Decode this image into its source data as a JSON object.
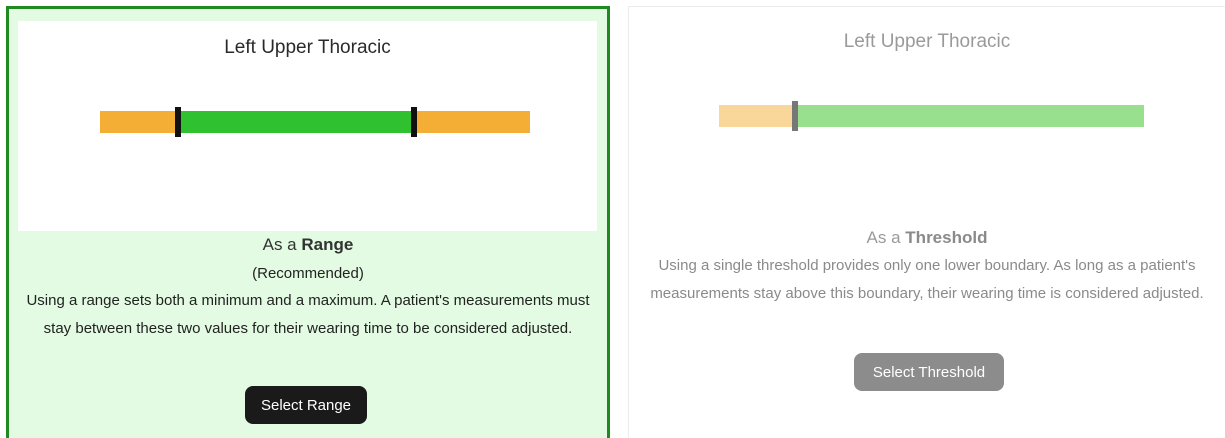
{
  "range_option": {
    "preview_title": "Left Upper Thoracic",
    "heading_prefix": "As a",
    "heading_bold": "Range",
    "subtitle": "(Recommended)",
    "description": "Using a range sets both a minimum and a maximum. A patient's measurements must stay between these two values for their wearing time to be considered adjusted.",
    "button_label": "Select Range",
    "selected": true,
    "colors": {
      "out_of_range": "#f5ae35",
      "in_range": "#2fc12f",
      "marker": "#111111",
      "border": "#1f8a1f",
      "background": "#e3fbe3"
    }
  },
  "threshold_option": {
    "preview_title": "Left Upper Thoracic",
    "heading_prefix": "As a",
    "heading_bold": "Threshold",
    "description": "Using a single threshold provides only one lower boundary. As long as a patient's measurements stay above this boundary, their wearing time is considered adjusted.",
    "button_label": "Select Threshold",
    "selected": false,
    "colors": {
      "below": "#f9d69a",
      "above": "#98e08e",
      "marker": "#777777",
      "button": "#8c8c8c"
    }
  }
}
